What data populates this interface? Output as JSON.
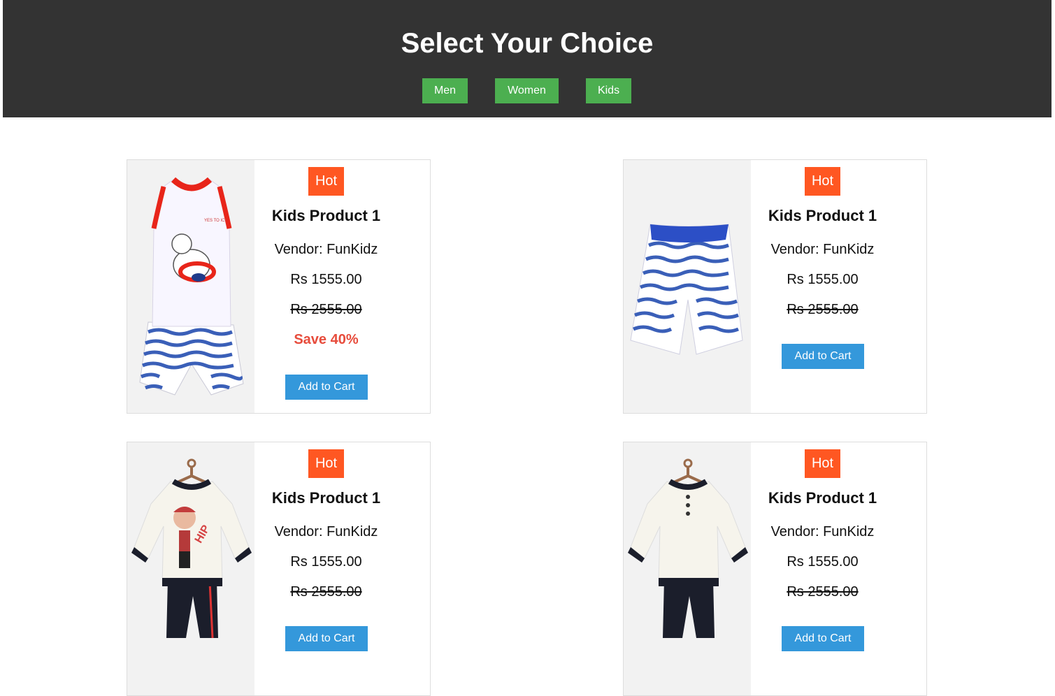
{
  "header": {
    "title": "Select Your Choice",
    "nav": [
      "Men",
      "Women",
      "Kids"
    ]
  },
  "colors": {
    "header_bg": "#333333",
    "nav_button": "#4caf50",
    "hot_badge": "#ff5722",
    "cart_button": "#3498db",
    "save_text": "#e74c3c"
  },
  "products": [
    {
      "badge": "Hot",
      "title": "Kids Product 1",
      "vendor": "Vendor: FunKidz",
      "price": "Rs 1555.00",
      "old_price": "Rs 2555.00",
      "save": "Save 40%",
      "button": "Add to Cart",
      "image": "sleeveless-top-and-striped-shorts"
    },
    {
      "badge": "Hot",
      "title": "Kids Product 1",
      "vendor": "Vendor: FunKidz",
      "price": "Rs 1555.00",
      "old_price": "Rs 2555.00",
      "button": "Add to Cart",
      "image": "striped-shorts"
    },
    {
      "badge": "Hot",
      "title": "Kids Product 1",
      "vendor": "Vendor: FunKidz",
      "price": "Rs 1555.00",
      "old_price": "Rs 2555.00",
      "button": "Add to Cart",
      "image": "printed-sweatshirt-and-joggers"
    },
    {
      "badge": "Hot",
      "title": "Kids Product 1",
      "vendor": "Vendor: FunKidz",
      "price": "Rs 1555.00",
      "old_price": "Rs 2555.00",
      "button": "Add to Cart",
      "image": "plain-sweatshirt-and-joggers"
    }
  ]
}
